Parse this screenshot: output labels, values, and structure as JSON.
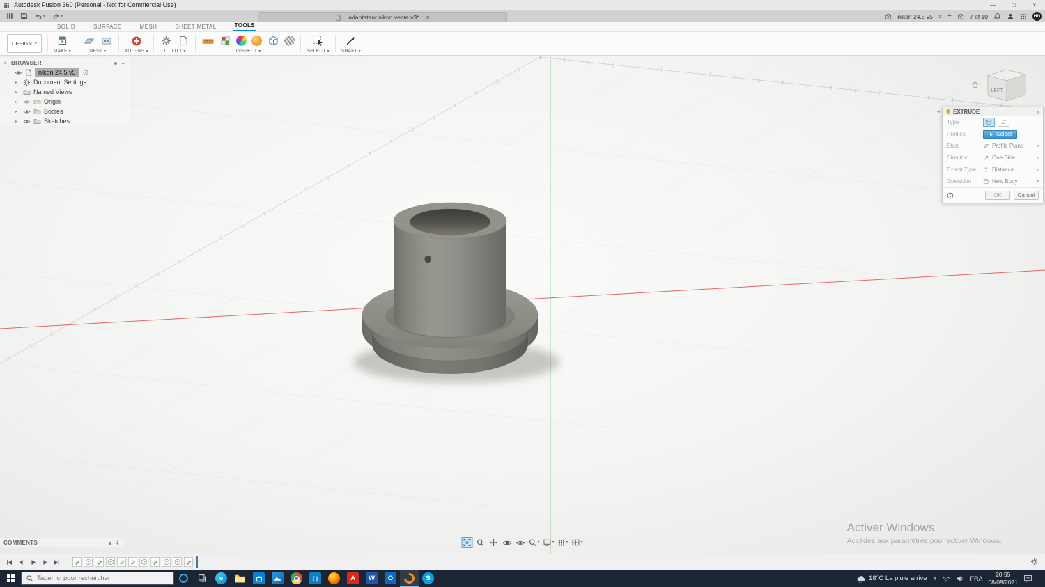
{
  "titlebar": {
    "title": "Autodesk Fusion 360 (Personal - Not for Commercial Use)",
    "controls": {
      "minimize": "—",
      "maximize": "□",
      "close": "×"
    }
  },
  "quick_access": {
    "icons": [
      "app-launcher",
      "save",
      "undo",
      "redo"
    ]
  },
  "tabbar": {
    "document_tab": {
      "label": "adaptateur nikon vente v3*",
      "close": "×"
    },
    "active_doc": {
      "label": "nikon 24.5 v5",
      "close": "×"
    },
    "new_tab_label": "+",
    "job_status": "7 of 10",
    "profile_badge": "HD"
  },
  "ribbon": {
    "workspace": "DESIGN",
    "tabs": [
      {
        "label": "SOLID",
        "active": false
      },
      {
        "label": "SURFACE",
        "active": false
      },
      {
        "label": "MESH",
        "active": false
      },
      {
        "label": "SHEET METAL",
        "active": false
      },
      {
        "label": "TOOLS",
        "active": true
      }
    ],
    "groups": [
      {
        "label": "MAKE"
      },
      {
        "label": "NEST"
      },
      {
        "label": "ADD-INS"
      },
      {
        "label": "UTILITY"
      },
      {
        "label": "INSPECT"
      },
      {
        "label": "SELECT"
      },
      {
        "label": "SHAFT"
      }
    ]
  },
  "browser": {
    "title": "BROWSER",
    "root_label": "nikon 24.5 v5",
    "items": [
      {
        "label": "Document Settings",
        "icon": "gear",
        "eye": false
      },
      {
        "label": "Named Views",
        "icon": "folder",
        "eye": false
      },
      {
        "label": "Origin",
        "icon": "folder",
        "eye": true
      },
      {
        "label": "Bodies",
        "icon": "folder",
        "eye": true
      },
      {
        "label": "Sketches",
        "icon": "folder",
        "eye": true
      }
    ]
  },
  "viewcube": {
    "face": "LEFT"
  },
  "extrude": {
    "title": "EXTRUDE",
    "type_label": "Type",
    "type_options": [
      "extrude",
      "thin-extrude"
    ],
    "profiles_label": "Profiles",
    "profiles_value": "Select",
    "start_label": "Start",
    "start_value": "Profile Plane",
    "direction_label": "Direction",
    "direction_value": "One Side",
    "extent_label": "Extent Type",
    "extent_value": "Distance",
    "operation_label": "Operation",
    "operation_value": "New Body",
    "ok_label": "OK",
    "cancel_label": "Cancel"
  },
  "navbar": {
    "icons": [
      "fit-view",
      "zoom",
      "pan",
      "orbit",
      "look-at",
      "zoom-window",
      "display-settings",
      "grid-display",
      "viewports"
    ]
  },
  "comments": {
    "title": "COMMENTS"
  },
  "watermark": {
    "title": "Activer Windows",
    "subtitle": "Accédez aux paramètres pour activer Windows."
  },
  "timeline": {
    "playback_icons": [
      "skip-start",
      "step-back",
      "play",
      "step-forward",
      "skip-end"
    ],
    "feature_icons": [
      "sketch",
      "extrude",
      "sketch",
      "extrude",
      "sketch",
      "sketch",
      "extrude",
      "sketch",
      "extrude",
      "extrude",
      "sketch"
    ]
  },
  "taskbar": {
    "search_placeholder": "Taper ici pour rechercher",
    "apps": [
      "microsoft-edge",
      "file-explorer",
      "microsoft-store",
      "photos",
      "google-chrome",
      "vs-code",
      "firefox",
      "adobe-acrobat",
      "word",
      "outlook",
      "fusion-360",
      "skype"
    ],
    "active_app": "fusion-360",
    "tray": {
      "weather": "18°C La pluie arrive",
      "language": "FRA",
      "time": "20:55",
      "date": "08/08/2021"
    }
  }
}
